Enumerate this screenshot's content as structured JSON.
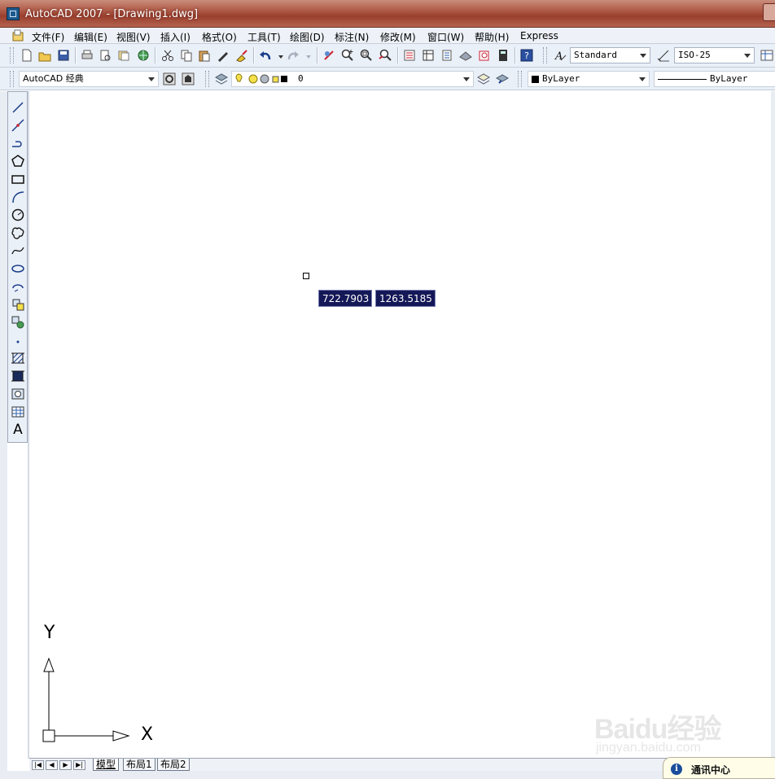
{
  "window": {
    "title": "AutoCAD 2007 - [Drawing1.dwg]"
  },
  "menubar": {
    "items": [
      "文件(F)",
      "编辑(E)",
      "视图(V)",
      "插入(I)",
      "格式(O)",
      "工具(T)",
      "绘图(D)",
      "标注(N)",
      "修改(M)",
      "窗口(W)",
      "帮助(H)",
      "Express"
    ]
  },
  "styles_toolbar": {
    "text_style": "Standard",
    "dim_style": "ISO-25"
  },
  "workspace_toolbar": {
    "workspace": "AutoCAD 经典"
  },
  "layers_toolbar": {
    "current_layer": "0"
  },
  "properties_toolbar": {
    "color": "ByLayer",
    "linetype": "ByLayer"
  },
  "canvas": {
    "coord_x": "722.7903",
    "coord_y": "1263.5185",
    "ucs_x_label": "X",
    "ucs_y_label": "Y"
  },
  "layout_tabs": [
    "模型",
    "布局1",
    "布局2"
  ],
  "comm_center": {
    "label": "通讯中心"
  },
  "watermark": {
    "brand": "Baidu经验",
    "url": "jingyan.baidu.com"
  },
  "colors": {
    "titlebar": "#a34a38",
    "toolbar_bg": "#eaf0f8",
    "dynamic_input_bg": "#141857"
  }
}
